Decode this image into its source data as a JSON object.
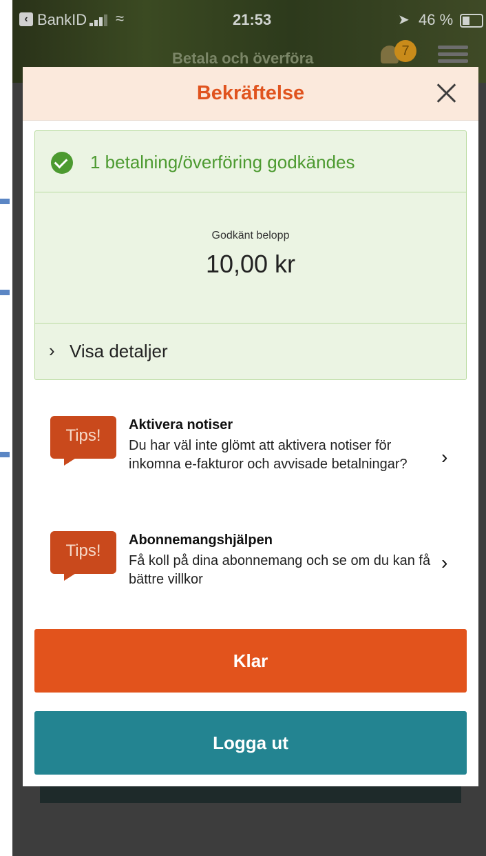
{
  "status_bar": {
    "carrier": "BankID",
    "time": "21:53",
    "battery": "46 %",
    "battery_level": 0.46
  },
  "app_bar": {
    "title": "Betala och överföra",
    "notification_count": "7"
  },
  "modal": {
    "title": "Bekräftelse",
    "success": {
      "message": "1 betalning/överföring godkändes",
      "amount_label": "Godkänt belopp",
      "amount_value": "10,00 kr",
      "details_label": "Visa detaljer"
    },
    "tips": [
      {
        "badge": "Tips!",
        "title": "Aktivera notiser",
        "body": "Du har väl inte glömt att aktivera notiser för inkomna e-fakturor och avvisade betalningar?"
      },
      {
        "badge": "Tips!",
        "title": "Abonnemangshjälpen",
        "body": "Få koll på dina abonnemang och se om du kan få bättre villkor"
      }
    ],
    "buttons": {
      "done": "Klar",
      "logout": "Logga ut"
    }
  },
  "colors": {
    "accent_orange": "#e2531c",
    "success_green": "#4c9a30",
    "logout_teal": "#238491"
  }
}
